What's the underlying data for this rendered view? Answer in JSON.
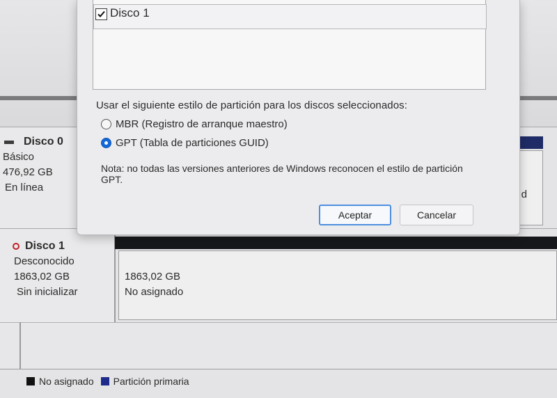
{
  "dialog": {
    "disk_list": [
      {
        "label": "Disco 1",
        "checked": true
      }
    ],
    "prompt": "Usar el siguiente estilo de partición para los discos seleccionados:",
    "options": [
      {
        "label": "MBR (Registro de arranque maestro)",
        "selected": false
      },
      {
        "label": "GPT (Tabla de particiones GUID)",
        "selected": true
      }
    ],
    "note": "Nota: no todas las versiones anteriores de Windows reconocen el estilo de partición GPT.",
    "ok_label": "Aceptar",
    "cancel_label": "Cancelar"
  },
  "disks": [
    {
      "name": "Disco 0",
      "type": "Básico",
      "size": "476,92 GB",
      "status": "En línea",
      "partition_fragment": "ción d"
    },
    {
      "name": "Disco 1",
      "type": "Desconocido",
      "size": "1863,02 GB",
      "status": "Sin inicializar",
      "unallocated_size": "1863,02 GB",
      "unallocated_label": "No asignado"
    }
  ],
  "legend": [
    {
      "label": "No asignado",
      "color": "#111111"
    },
    {
      "label": "Partición primaria",
      "color": "#1e2b8a"
    }
  ],
  "colors": {
    "primary_partition": "#1e2b66",
    "unallocated": "#16171a",
    "radio_selected": "#1468d8",
    "offline_icon": "#c0202a"
  }
}
